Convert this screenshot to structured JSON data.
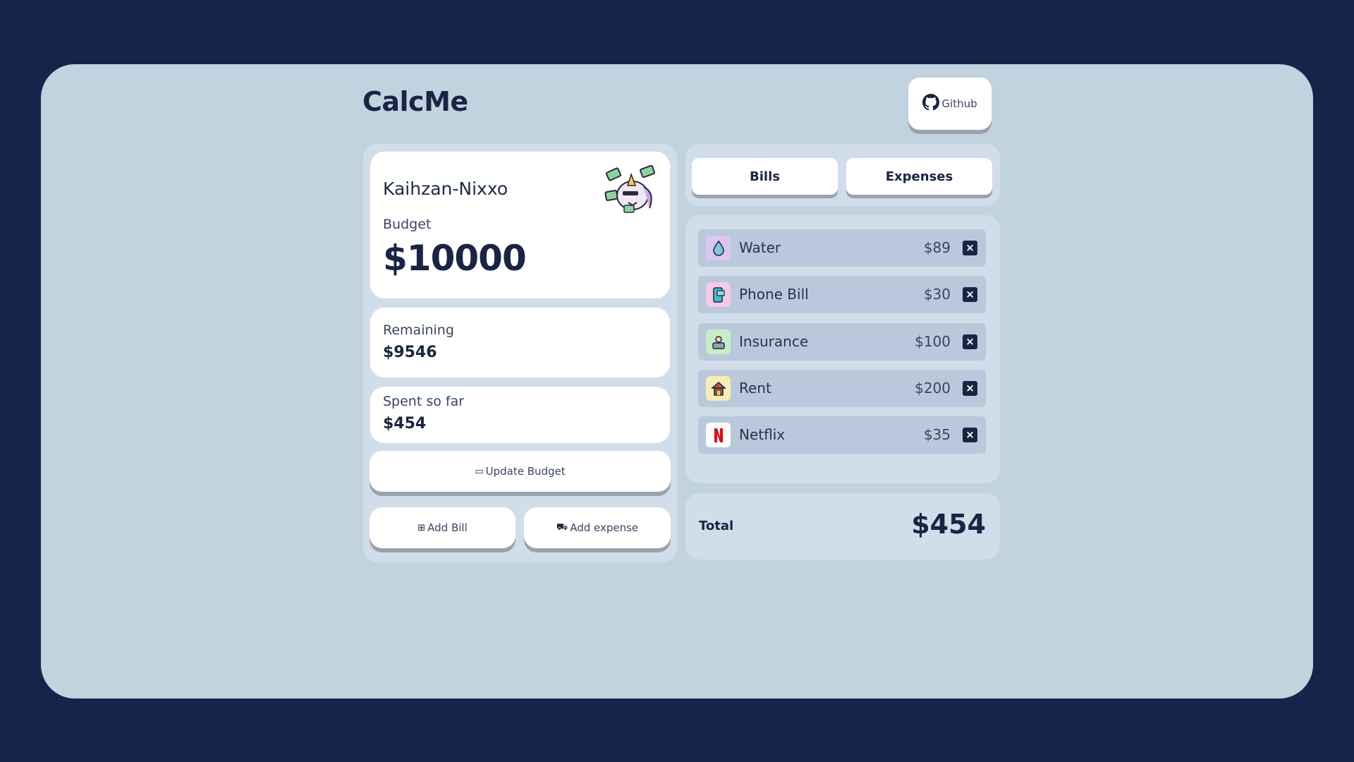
{
  "app": {
    "title": "CalcMe"
  },
  "header": {
    "github_label": "Github",
    "github_icon": "github-icon"
  },
  "profile": {
    "username": "Kaihzan-Nixxo",
    "budget_label": "Budget",
    "budget_value": "$10000",
    "mascot": "unicorn-money-mascot"
  },
  "stats": {
    "remaining_label": "Remaining",
    "remaining_value": "$9546",
    "spent_label": "Spent so far",
    "spent_value": "$454"
  },
  "actions": {
    "update_budget": "Update Budget",
    "add_bill": "Add Bill",
    "add_expense": "Add expense"
  },
  "tabs": [
    {
      "label": "Bills",
      "active": true
    },
    {
      "label": "Expenses",
      "active": false
    }
  ],
  "bills": [
    {
      "name": "Water",
      "amount": "$89",
      "icon": "water-drop-icon",
      "icon_bg": "#d9c7f2"
    },
    {
      "name": "Phone Bill",
      "amount": "$30",
      "icon": "phone-icon",
      "icon_bg": "#f6c9e6"
    },
    {
      "name": "Insurance",
      "amount": "$100",
      "icon": "insurance-icon",
      "icon_bg": "#c6efc9"
    },
    {
      "name": "Rent",
      "amount": "$200",
      "icon": "house-icon",
      "icon_bg": "#f7ecb4"
    },
    {
      "name": "Netflix",
      "amount": "$35",
      "icon": "netflix-icon",
      "icon_bg": "#ffffff"
    }
  ],
  "total": {
    "label": "Total",
    "value": "$454"
  },
  "colors": {
    "page_bg": "#16244a",
    "frame_bg": "#c0d3df",
    "panel_bg": "#d2ddea",
    "item_bg": "#b9c9db",
    "text_dark": "#1a2444"
  }
}
